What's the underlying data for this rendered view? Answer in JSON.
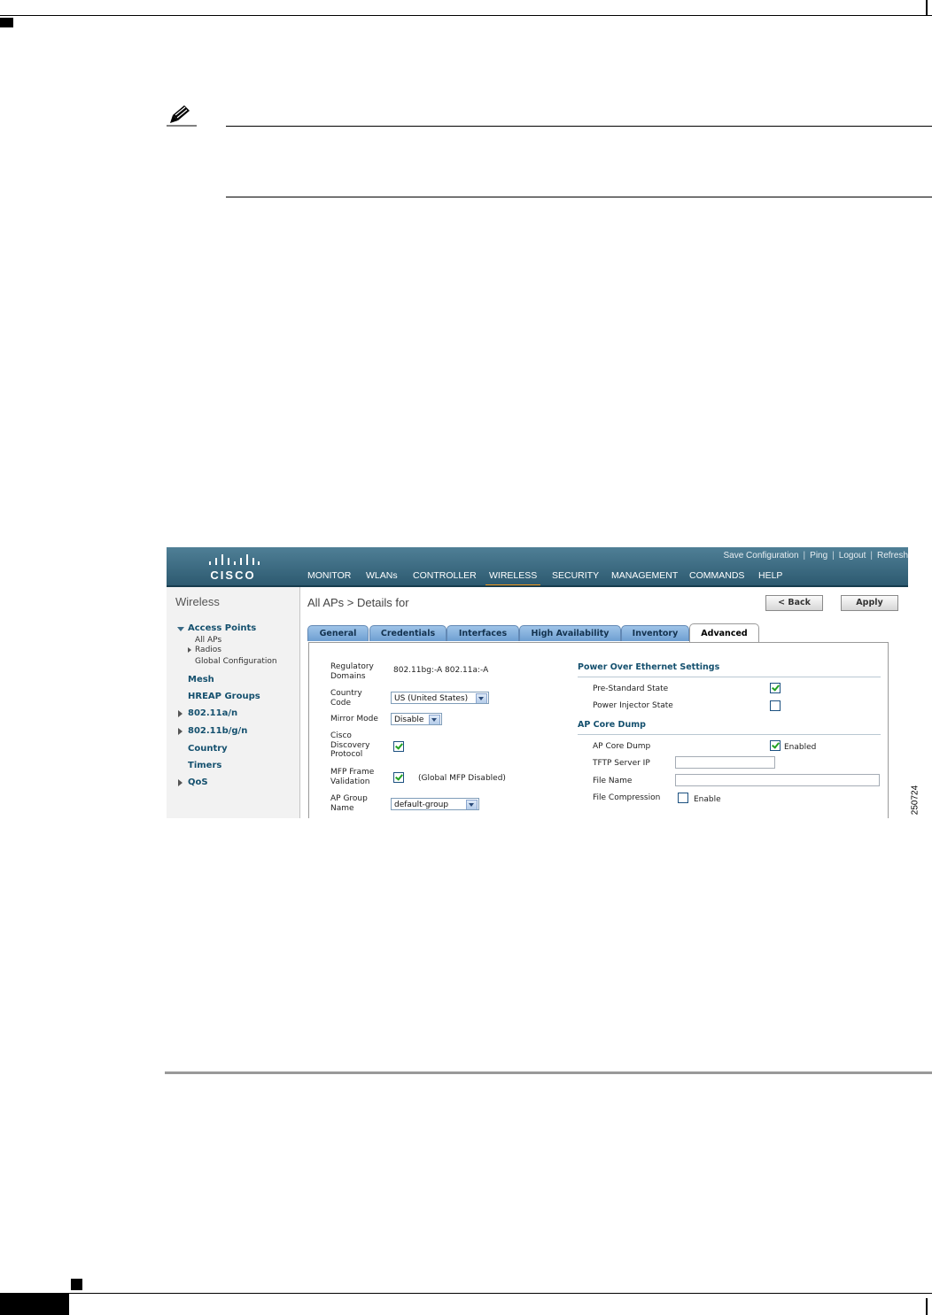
{
  "figure_id": "250724",
  "header": {
    "logo_text": "CISCO",
    "utility_links": [
      {
        "label": "Save Configuration"
      },
      {
        "label": "Ping"
      },
      {
        "label": "Logout"
      },
      {
        "label": "Refresh"
      }
    ],
    "menu": [
      {
        "label": "MONITOR",
        "active": false
      },
      {
        "label": "WLANs",
        "active": false
      },
      {
        "label": "CONTROLLER",
        "active": false
      },
      {
        "label": "WIRELESS",
        "active": true
      },
      {
        "label": "SECURITY",
        "active": false
      },
      {
        "label": "MANAGEMENT",
        "active": false
      },
      {
        "label": "COMMANDS",
        "active": false
      },
      {
        "label": "HELP",
        "active": false
      }
    ]
  },
  "sidebar": {
    "title": "Wireless",
    "access_points": "Access Points",
    "all_aps": "All APs",
    "radios": "Radios",
    "global_config": "Global Configuration",
    "mesh": "Mesh",
    "hreap": "HREAP Groups",
    "dot11an": "802.11a/n",
    "dot11bgn": "802.11b/g/n",
    "country": "Country",
    "timers": "Timers",
    "qos": "QoS"
  },
  "page": {
    "title": "All APs > Details for",
    "back_label": "< Back",
    "apply_label": "Apply"
  },
  "tabs": [
    {
      "label": "General",
      "active": false
    },
    {
      "label": "Credentials",
      "active": false
    },
    {
      "label": "Interfaces",
      "active": false
    },
    {
      "label": "High Availability",
      "active": false
    },
    {
      "label": "Inventory",
      "active": false
    },
    {
      "label": "Advanced",
      "active": true
    }
  ],
  "left": {
    "regulatory_label_1": "Regulatory",
    "regulatory_label_2": "Domains",
    "regulatory_value": "802.11bg:-A   802.11a:-A",
    "country_label_1": "Country",
    "country_label_2": "Code",
    "country_value": "US (United States)",
    "mirror_label": "Mirror Mode",
    "mirror_value": "Disable",
    "cdp_label_1": "Cisco",
    "cdp_label_2": "Discovery",
    "cdp_label_3": "Protocol",
    "cdp_checked": true,
    "mfp_label_1": "MFP Frame",
    "mfp_label_2": "Validation",
    "mfp_checked": true,
    "mfp_note": "(Global MFP Disabled)",
    "apgroup_label_1": "AP Group",
    "apgroup_label_2": "Name",
    "apgroup_value": "default-group"
  },
  "right": {
    "poe_title": "Power Over Ethernet Settings",
    "prestandard_label": "Pre-Standard State",
    "prestandard_checked": true,
    "injector_label": "Power Injector State",
    "injector_checked": false,
    "coredump_title": "AP Core Dump",
    "coredump_label": "AP Core Dump",
    "coredump_checked": true,
    "coredump_enabled_label": "Enabled",
    "tftp_label": "TFTP Server IP",
    "tftp_value": "",
    "filename_label": "File Name",
    "filename_value": "",
    "compression_label": "File Compression",
    "compression_checked": false,
    "compression_enable_label": "Enable"
  }
}
